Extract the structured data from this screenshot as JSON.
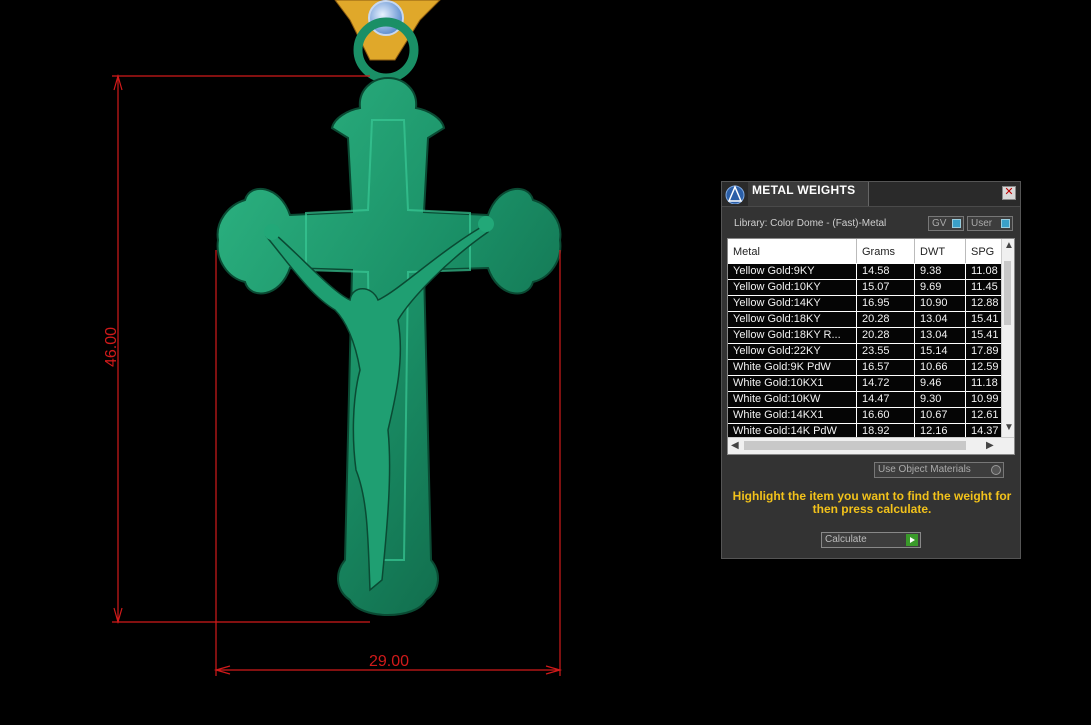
{
  "dimensions": {
    "height": "46.00",
    "width": "29.00"
  },
  "colors": {
    "dimension_line": "#d11a1a",
    "model": "#1a8f66",
    "hint_text": "#f2c21b",
    "gem": "#9ec5f2",
    "bail": "#e0a82a"
  },
  "panel": {
    "title": "METAL WEIGHTS",
    "close_label": "✕",
    "library": "Library: Color Dome - (Fast)-Metal",
    "gv_toggle": "GV",
    "user_toggle": "User",
    "columns": [
      "Metal",
      "Grams",
      "DWT",
      "SPG"
    ],
    "rows": [
      [
        "Yellow Gold:9KY",
        "14.58",
        "9.38",
        "11.08"
      ],
      [
        "Yellow Gold:10KY",
        "15.07",
        "9.69",
        "11.45"
      ],
      [
        "Yellow Gold:14KY",
        "16.95",
        "10.90",
        "12.88"
      ],
      [
        "Yellow Gold:18KY",
        "20.28",
        "13.04",
        "15.41"
      ],
      [
        "Yellow Gold:18KY R...",
        "20.28",
        "13.04",
        "15.41"
      ],
      [
        "Yellow Gold:22KY",
        "23.55",
        "15.14",
        "17.89"
      ],
      [
        "White Gold:9K PdW",
        "16.57",
        "10.66",
        "12.59"
      ],
      [
        "White Gold:10KX1",
        "14.72",
        "9.46",
        "11.18"
      ],
      [
        "White Gold:10KW",
        "14.47",
        "9.30",
        "10.99"
      ],
      [
        "White Gold:14KX1",
        "16.60",
        "10.67",
        "12.61"
      ],
      [
        "White Gold:14K PdW",
        "18.92",
        "12.16",
        "14.37"
      ]
    ],
    "use_object_materials": "Use Object Materials",
    "hint": "Highlight the item you want to find the weight for then press calculate.",
    "calculate_label": "Calculate"
  }
}
